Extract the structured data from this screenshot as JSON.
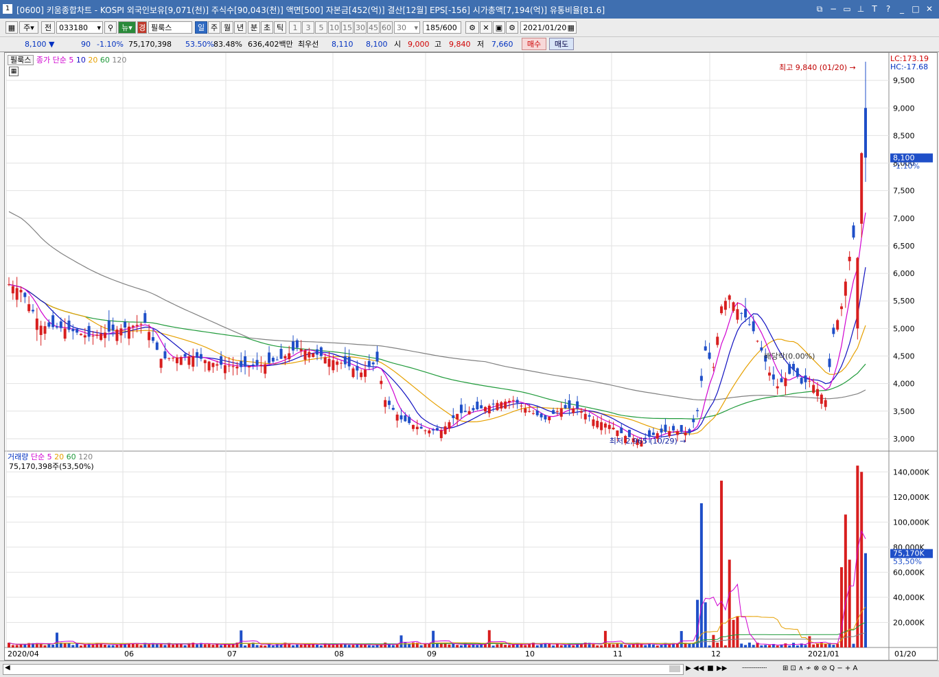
{
  "window": {
    "number": "1",
    "title": "[0600] 키움종합차트 - KOSPI 외국인보유[9,071(천)] 주식수[90,043(천)] 액면[500] 자본금[452(억)] 결산[12월] EPS[-156] 시가총액[7,194(억)] 유통비율[81.6]"
  },
  "toolbar": {
    "mode_ju": "주",
    "mode_jeon": "전",
    "code": "033180",
    "stock_name": "필룩스",
    "periods": [
      "일",
      "주",
      "월",
      "년",
      "분",
      "초",
      "틱"
    ],
    "selected_period": "일",
    "intervals": [
      "1",
      "3",
      "5",
      "10",
      "15",
      "30",
      "45",
      "60"
    ],
    "interval_value": "30",
    "count": "185",
    "count_max": "/600",
    "date": "2021/01/20",
    "icon_names": [
      "layout-icon",
      "search-icon",
      "news-icon",
      "chart-tools-icon",
      "save-icon",
      "settings-icon",
      "calendar-icon"
    ]
  },
  "quote": {
    "price": "8,100",
    "arrow": "▼",
    "change": "90",
    "change_pct": "-1.10%",
    "volume": "75,170,398",
    "vol_ratio": "53.50%",
    "turnover": "83.48%",
    "amount": "636,402백만",
    "best_label": "최우선",
    "ask": "8,110",
    "bid": "8,100",
    "open_label": "시",
    "open": "9,000",
    "high_label": "고",
    "high": "9,840",
    "low_label": "저",
    "low": "7,660",
    "buy_label": "매수",
    "sell_label": "매도"
  },
  "price_panel": {
    "name": "필룩스",
    "legend_close": "종가 단순",
    "ma_labels": [
      "5",
      "10",
      "20",
      "60",
      "120"
    ],
    "ma_colors": [
      "#d000d0",
      "#1010c0",
      "#e6a000",
      "#1f9a3a",
      "#808080"
    ],
    "lc": "LC:173.19",
    "hc": "HC:-17.68",
    "high_annot": "최고 9,840 (01/20)",
    "low_annot": "최저 2,965 (10/29)",
    "dividend_annot": "배당락(0.00%)",
    "current_price_label": "8,100",
    "current_change_label": "-1.10%",
    "y_ticks": [
      "9,500",
      "9,000",
      "8,500",
      "8,000",
      "7,500",
      "7,000",
      "6,500",
      "6,000",
      "5,500",
      "5,000",
      "4,500",
      "4,000",
      "3,500",
      "3,000"
    ]
  },
  "volume_panel": {
    "title": "거래량",
    "legend_simple": "단순",
    "ma_labels": [
      "5",
      "20",
      "60",
      "120"
    ],
    "summary": "75,170,398주(53,50%)",
    "current_label": "75,170K",
    "current_pct": "53,50%",
    "y_ticks": [
      "140,000K",
      "120,000K",
      "100,000K",
      "80,000K",
      "60,000K",
      "40,000K",
      "20,000K"
    ]
  },
  "x_axis": {
    "labels": [
      "2020/04",
      "06",
      "07",
      "08",
      "09",
      "10",
      "11",
      "12",
      "2021/01"
    ],
    "right_label": "01/20"
  },
  "bottom": {
    "tools": "⊞ ⊡ ∧ ≁ ⊗ ⊘ Q − + A"
  },
  "chart_data": {
    "type": "candlestick",
    "title": "필룩스",
    "ylim": [
      2800,
      9900
    ],
    "volume_ylim": [
      0,
      150000
    ],
    "volume_unit": "K",
    "last": {
      "date": "2021/01/20",
      "open": 9000,
      "high": 9840,
      "low": 7660,
      "close": 8100,
      "volume_k": 75170
    },
    "anchors": [
      {
        "date": "2020/04",
        "close": 5800
      },
      {
        "date": "2020/06",
        "close": 5000
      },
      {
        "date": "2020/07",
        "close": 4400
      },
      {
        "date": "2020/08",
        "close": 4300
      },
      {
        "date": "2020/09",
        "close": 3500
      },
      {
        "date": "2020/10",
        "close": 3500
      },
      {
        "date": "2020/10/29",
        "close": 2965
      },
      {
        "date": "2020/11",
        "close": 3100
      },
      {
        "date": "2020/12",
        "close": 5500
      },
      {
        "date": "2021/01",
        "close": 4000
      },
      {
        "date": "2021/01/20",
        "close": 8100
      }
    ],
    "highs": {
      "max": 9840,
      "max_date": "2021/01/20",
      "min": 2965,
      "min_date": "2020/10/29"
    }
  }
}
